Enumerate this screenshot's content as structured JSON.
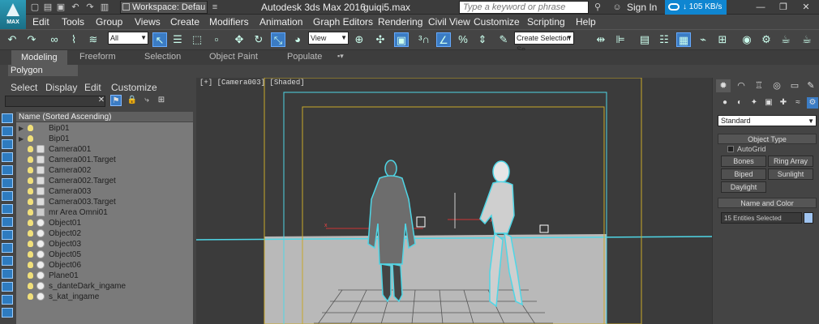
{
  "titlebar": {
    "workspace": "Workspace: Defau",
    "app_title": "Autodesk 3ds Max 2016",
    "file_name": "guiqi5.max",
    "search_placeholder": "Type a keyword or phrase",
    "signin": "Sign In",
    "net_speed": "105 KB/s",
    "logo_text": "MAX"
  },
  "menu": [
    "Edit",
    "Tools",
    "Group",
    "Views",
    "Create",
    "Modifiers",
    "Animation",
    "Graph Editors",
    "Rendering",
    "Civil View",
    "Customize",
    "Scripting",
    "Help"
  ],
  "toolbar": {
    "selection_filter": "All",
    "ref_coord": "View",
    "named_selection": "Create Selection Se"
  },
  "ribbon": {
    "tabs": [
      "Modeling",
      "Freeform",
      "Selection",
      "Object Paint",
      "Populate"
    ],
    "active_tab": "Modeling",
    "sub_label": "Polygon Modeling"
  },
  "scene_explorer": {
    "tabs": [
      "Select",
      "Display",
      "Edit",
      "Customize"
    ],
    "header": "Name (Sorted Ascending)",
    "rows": [
      {
        "name": "Bip01",
        "expand": true
      },
      {
        "name": "Bip01",
        "expand": true
      },
      {
        "name": "Camera001",
        "expand": false
      },
      {
        "name": "Camera001.Target",
        "expand": false
      },
      {
        "name": "Camera002",
        "expand": false
      },
      {
        "name": "Camera002.Target",
        "expand": false
      },
      {
        "name": "Camera003",
        "expand": false
      },
      {
        "name": "Camera003.Target",
        "expand": false
      },
      {
        "name": "mr Area Omni01",
        "expand": false
      },
      {
        "name": "Object01",
        "expand": false
      },
      {
        "name": "Object02",
        "expand": false
      },
      {
        "name": "Object03",
        "expand": false
      },
      {
        "name": "Object05",
        "expand": false
      },
      {
        "name": "Object06",
        "expand": false
      },
      {
        "name": "Plane01",
        "expand": false
      },
      {
        "name": "s_danteDark_ingame",
        "expand": false
      },
      {
        "name": "s_kat_ingame",
        "expand": false
      }
    ]
  },
  "viewport": {
    "label": "[+] [Camera003] [Shaded]"
  },
  "command_panel": {
    "dropdown": "Standard",
    "object_type_title": "Object Type",
    "autogrid": "AutoGrid",
    "buttons": [
      "Bones",
      "Ring Array",
      "Biped",
      "Sunlight",
      "Daylight"
    ],
    "name_color_title": "Name and Color",
    "entities": "15 Entities Selected"
  },
  "colors": {
    "accent": "#3b7cc4",
    "highlight": "#4fd6e6",
    "safe_frame": "#c8a82a"
  }
}
